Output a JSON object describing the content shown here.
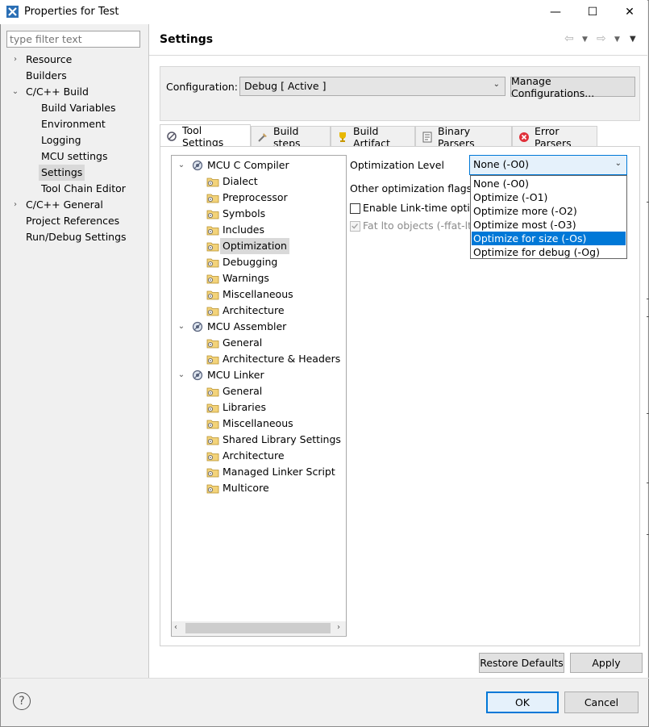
{
  "window": {
    "title": "Properties for Test",
    "minimize_glyph": "—",
    "maximize_glyph": "☐",
    "close_glyph": "✕"
  },
  "filter": {
    "placeholder": "type filter text"
  },
  "nav": {
    "items": [
      {
        "label": "Resource",
        "chevron": "›",
        "indent": 0
      },
      {
        "label": "Builders",
        "chevron": "",
        "indent": 0
      },
      {
        "label": "C/C++ Build",
        "chevron": "⌄",
        "indent": 0
      },
      {
        "label": "Build Variables",
        "chevron": "",
        "indent": 1
      },
      {
        "label": "Environment",
        "chevron": "",
        "indent": 1
      },
      {
        "label": "Logging",
        "chevron": "",
        "indent": 1
      },
      {
        "label": "MCU settings",
        "chevron": "",
        "indent": 1
      },
      {
        "label": "Settings",
        "chevron": "",
        "indent": 1,
        "selected": true
      },
      {
        "label": "Tool Chain Editor",
        "chevron": "",
        "indent": 1
      },
      {
        "label": "C/C++ General",
        "chevron": "›",
        "indent": 0
      },
      {
        "label": "Project References",
        "chevron": "",
        "indent": 0
      },
      {
        "label": "Run/Debug Settings",
        "chevron": "",
        "indent": 0
      }
    ]
  },
  "header": {
    "title": "Settings"
  },
  "configuration": {
    "label": "Configuration:",
    "value": "Debug  [ Active ]",
    "manage_button": "Manage Configurations..."
  },
  "tabs": [
    {
      "label": "Tool Settings",
      "icon": "tool-settings-icon",
      "active": true
    },
    {
      "label": "Build steps",
      "icon": "build-steps-icon"
    },
    {
      "label": "Build Artifact",
      "icon": "trophy-icon"
    },
    {
      "label": "Binary Parsers",
      "icon": "binary-parsers-icon"
    },
    {
      "label": "Error Parsers",
      "icon": "error-icon"
    }
  ],
  "tool_tree": [
    {
      "label": "MCU C Compiler",
      "level": 0,
      "icon": "gear-tool-icon"
    },
    {
      "label": "Dialect",
      "level": 1,
      "icon": "folder-settings-icon"
    },
    {
      "label": "Preprocessor",
      "level": 1,
      "icon": "folder-settings-icon"
    },
    {
      "label": "Symbols",
      "level": 1,
      "icon": "folder-settings-icon"
    },
    {
      "label": "Includes",
      "level": 1,
      "icon": "folder-settings-icon"
    },
    {
      "label": "Optimization",
      "level": 1,
      "icon": "folder-settings-icon",
      "selected": true
    },
    {
      "label": "Debugging",
      "level": 1,
      "icon": "folder-settings-icon"
    },
    {
      "label": "Warnings",
      "level": 1,
      "icon": "folder-settings-icon"
    },
    {
      "label": "Miscellaneous",
      "level": 1,
      "icon": "folder-settings-icon"
    },
    {
      "label": "Architecture",
      "level": 1,
      "icon": "folder-settings-icon"
    },
    {
      "label": "MCU Assembler",
      "level": 0,
      "icon": "gear-tool-icon"
    },
    {
      "label": "General",
      "level": 1,
      "icon": "folder-settings-icon"
    },
    {
      "label": "Architecture & Headers",
      "level": 1,
      "icon": "folder-settings-icon"
    },
    {
      "label": "MCU Linker",
      "level": 0,
      "icon": "gear-tool-icon"
    },
    {
      "label": "General",
      "level": 1,
      "icon": "folder-settings-icon"
    },
    {
      "label": "Libraries",
      "level": 1,
      "icon": "folder-settings-icon"
    },
    {
      "label": "Miscellaneous",
      "level": 1,
      "icon": "folder-settings-icon"
    },
    {
      "label": "Shared Library Settings",
      "level": 1,
      "icon": "folder-settings-icon"
    },
    {
      "label": "Architecture",
      "level": 1,
      "icon": "folder-settings-icon"
    },
    {
      "label": "Managed Linker Script",
      "level": 1,
      "icon": "folder-settings-icon"
    },
    {
      "label": "Multicore",
      "level": 1,
      "icon": "folder-settings-icon"
    }
  ],
  "optimization": {
    "level_label": "Optimization Level",
    "level_value": "None (-O0)",
    "other_flags_label": "Other optimization flags",
    "lto_label": "Enable Link-time optim",
    "fat_lto_label": "Fat lto objects (-ffat-lto",
    "dropdown": [
      {
        "label": "None (-O0)"
      },
      {
        "label": "Optimize (-O1)"
      },
      {
        "label": "Optimize more (-O2)"
      },
      {
        "label": "Optimize most (-O3)"
      },
      {
        "label": "Optimize for size (-Os)",
        "highlighted": true
      },
      {
        "label": "Optimize for debug (-Og)"
      }
    ]
  },
  "buttons": {
    "restore_defaults": "Restore Defaults",
    "apply": "Apply",
    "ok": "OK",
    "cancel": "Cancel",
    "help": "?"
  },
  "colors": {
    "accent": "#0078d7",
    "selection_gray": "#d9d9d9"
  }
}
